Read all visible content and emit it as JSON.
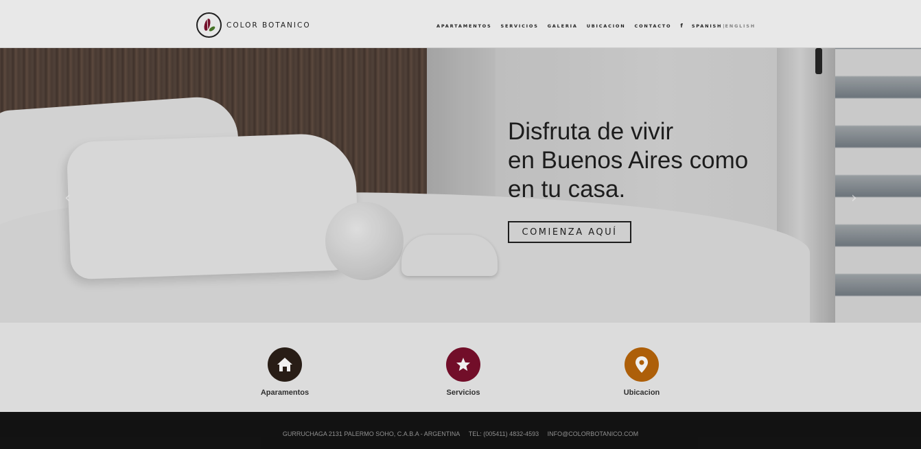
{
  "header": {
    "logo_text": "COLOR BOTANICO",
    "nav": [
      "APARTAMENTOS",
      "SERVICIOS",
      "GALERIA",
      "UBICACION",
      "CONTACTO"
    ],
    "facebook_label": "f",
    "lang_current": "SPANISH",
    "lang_separator": "|",
    "lang_alt": "ENGLISH"
  },
  "hero": {
    "title": "Disfruta de vivir\nen Buenos Aires como\nen tu casa.",
    "cta_label": "COMIENZA AQUÍ",
    "prev_arrow": "‹",
    "next_arrow": "›"
  },
  "features": [
    {
      "label": "Aparamentos",
      "icon": "home-icon",
      "color": "#2b1f18"
    },
    {
      "label": "Servicios",
      "icon": "star-icon",
      "color": "#7a0f2c"
    },
    {
      "label": "Ubicacion",
      "icon": "location-pin-icon",
      "color": "#b8650a"
    }
  ],
  "footer": {
    "address": "GURRUCHAGA 2131 PALERMO SOHO, C.A.B.A - ARGENTINA",
    "phone": "TEL: (005411) 4832-4593",
    "email": "INFO@COLORBOTANICO.COM"
  }
}
